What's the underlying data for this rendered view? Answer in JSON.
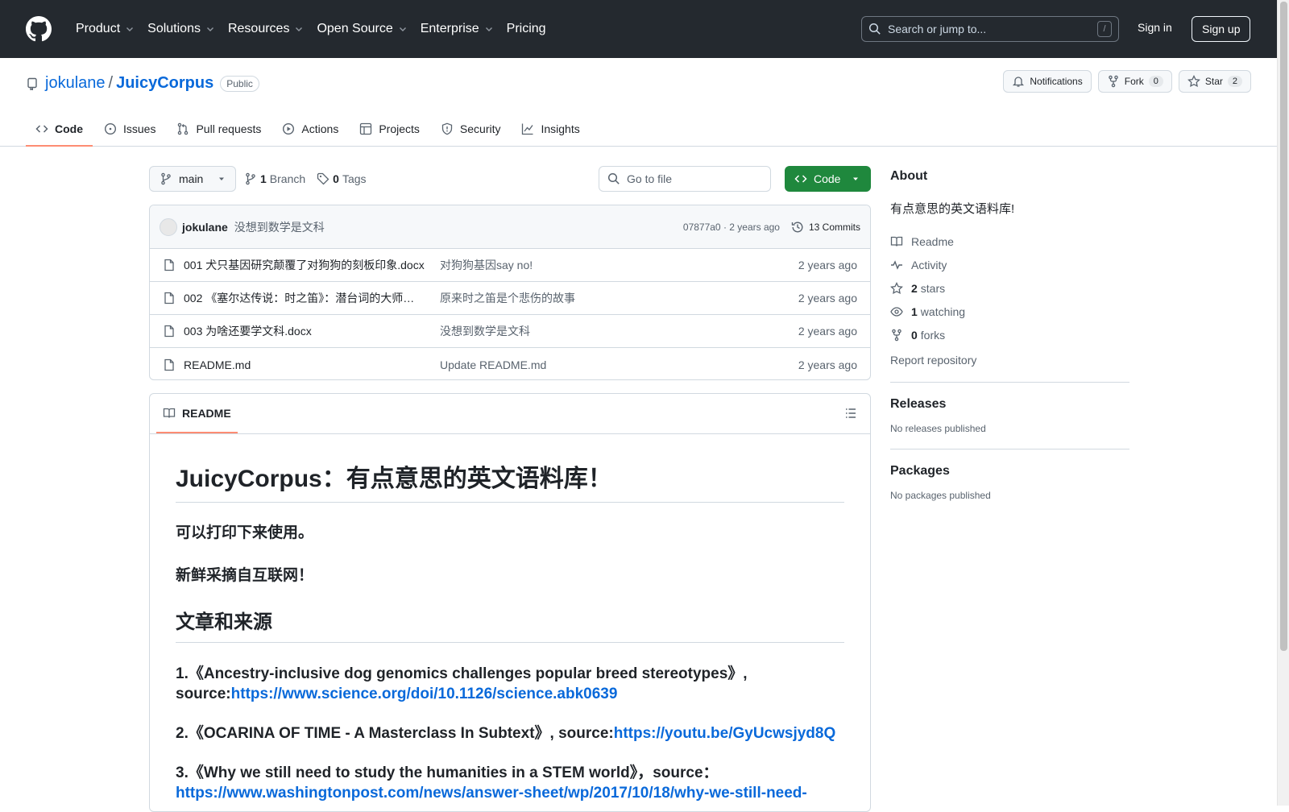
{
  "header": {
    "nav": [
      "Product",
      "Solutions",
      "Resources",
      "Open Source",
      "Enterprise",
      "Pricing"
    ],
    "search_placeholder": "Search or jump to...",
    "search_shortcut": "/",
    "sign_in": "Sign in",
    "sign_up": "Sign up"
  },
  "repo": {
    "owner": "jokulane",
    "name": "JuicyCorpus",
    "visibility": "Public",
    "notifications": "Notifications",
    "fork_label": "Fork",
    "fork_count": "0",
    "star_label": "Star",
    "star_count": "2",
    "tabs": [
      "Code",
      "Issues",
      "Pull requests",
      "Actions",
      "Projects",
      "Security",
      "Insights"
    ]
  },
  "toolbar": {
    "branch": "main",
    "branch_count": "1",
    "branch_label": "Branch",
    "tag_count": "0",
    "tag_label": "Tags",
    "goto_placeholder": "Go to file",
    "code_button": "Code"
  },
  "commit": {
    "author": "jokulane",
    "message": "没想到数学是文科",
    "hash_time": "07877a0 · 2 years ago",
    "commits": "13 Commits"
  },
  "files": [
    {
      "name": "001 犬只基因研究颠覆了对狗狗的刻板印象.docx",
      "message": "对狗狗基因say no!",
      "age": "2 years ago"
    },
    {
      "name": "002 《塞尔达传说：时之笛》：潜台词的大师…",
      "message": "原来时之笛是个悲伤的故事",
      "age": "2 years ago"
    },
    {
      "name": "003 为啥还要学文科.docx",
      "message": "没想到数学是文科",
      "age": "2 years ago"
    },
    {
      "name": "README.md",
      "message": "Update README.md",
      "age": "2 years ago"
    }
  ],
  "readme": {
    "tab": "README",
    "title": "JuicyCorpus：有点意思的英文语料库！",
    "line1": "可以打印下来使用。",
    "line2": "新鲜采摘自互联网！",
    "section": "文章和来源",
    "sources": [
      {
        "text": "1.《Ancestry-inclusive dog genomics challenges popular breed stereotypes》, source:",
        "link": "https://www.science.org/doi/10.1126/science.abk0639"
      },
      {
        "text": "2.《OCARINA OF TIME - A Masterclass In Subtext》, source:",
        "link": "https://youtu.be/GyUcwsjyd8Q"
      },
      {
        "text": "3.《Why we still need to study the humanities in a STEM world》，source：",
        "link": "https://www.washingtonpost.com/news/answer-sheet/wp/2017/10/18/why-we-still-need-"
      }
    ]
  },
  "sidebar": {
    "about": "About",
    "description": "有点意思的英文语料库!",
    "readme": "Readme",
    "activity": "Activity",
    "stars_count": "2",
    "stars_label": "stars",
    "watching_count": "1",
    "watching_label": "watching",
    "forks_count": "0",
    "forks_label": "forks",
    "report": "Report repository",
    "releases": "Releases",
    "no_releases": "No releases published",
    "packages": "Packages",
    "no_packages": "No packages published"
  }
}
